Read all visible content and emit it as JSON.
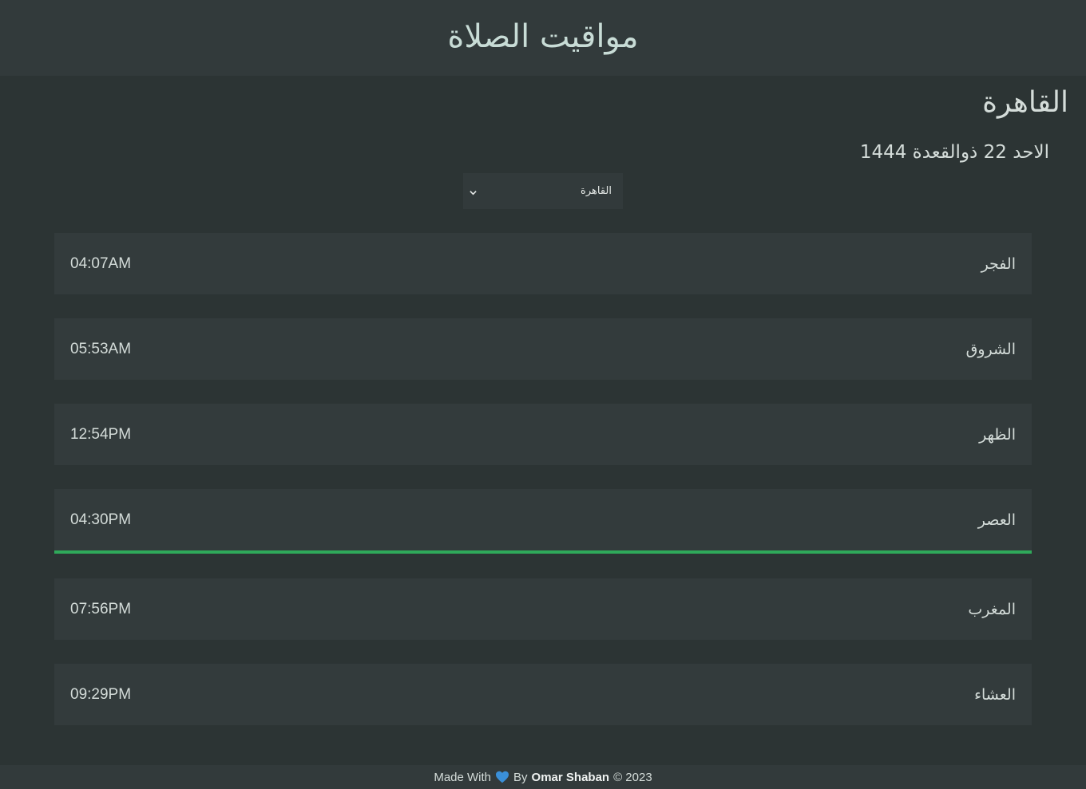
{
  "header": {
    "title": "مواقيت الصلاة"
  },
  "location": {
    "city": "القاهرة",
    "hijri_date": "الاحد 22 ذوالقعدة 1444"
  },
  "city_select": {
    "selected": "القاهرة",
    "icon": "chevron-down-icon"
  },
  "prayers": [
    {
      "name": "الفجر",
      "time": "04:07AM",
      "active": false
    },
    {
      "name": "الشروق",
      "time": "05:53AM",
      "active": false
    },
    {
      "name": "الظهر",
      "time": "12:54PM",
      "active": false
    },
    {
      "name": "العصر",
      "time": "04:30PM",
      "active": true
    },
    {
      "name": "المغرب",
      "time": "07:56PM",
      "active": false
    },
    {
      "name": "العشاء",
      "time": "09:29PM",
      "active": false
    }
  ],
  "footer": {
    "made_with": "Made With",
    "heart_icon": "blue-heart-icon",
    "by": "By",
    "author": "Omar Shaban",
    "copyright": "© 2023"
  },
  "colors": {
    "background": "#2c3434",
    "panel": "#333b3c",
    "active_accent": "#2fa95a",
    "heart": "#3a8fd8"
  }
}
